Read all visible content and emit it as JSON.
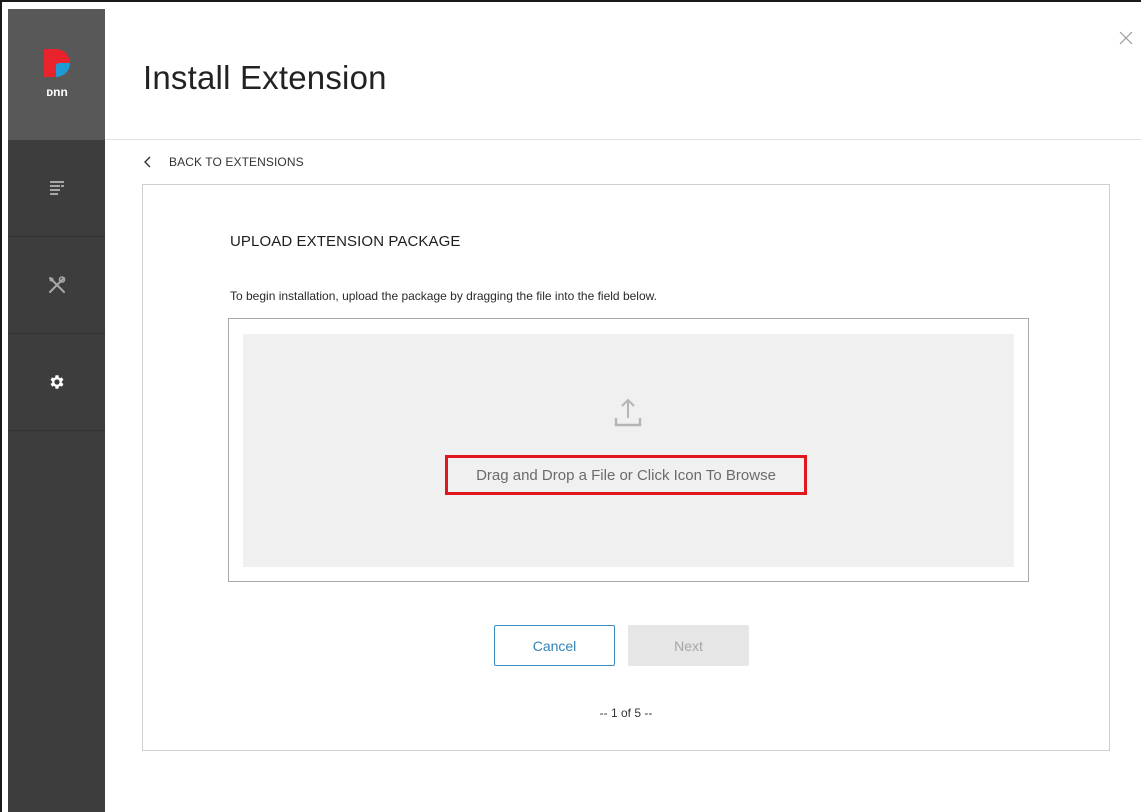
{
  "brand": {
    "logo_text": "DNN"
  },
  "sidebar": {
    "items": [
      {
        "icon": "content-list-icon"
      },
      {
        "icon": "tools-icon"
      },
      {
        "icon": "gear-icon"
      }
    ]
  },
  "header": {
    "title": "Install Extension",
    "close_icon": "close-icon"
  },
  "back_link": {
    "label": "BACK TO EXTENSIONS",
    "icon": "chevron-left-icon"
  },
  "card": {
    "section_title": "UPLOAD EXTENSION PACKAGE",
    "instructions": "To begin installation, upload the package by dragging the file into the field below.",
    "dropzone": {
      "icon": "upload-icon",
      "text": "Drag and Drop a File or Click Icon To Browse",
      "highlight_color": "#e0151e"
    },
    "buttons": {
      "cancel_label": "Cancel",
      "next_label": "Next"
    },
    "pager": "-- 1 of 5 --"
  },
  "colors": {
    "sidebar": "#3d3d3d",
    "logo_cell": "#585858",
    "accent_blue": "#3184b8",
    "highlight_red": "#e0151e"
  }
}
